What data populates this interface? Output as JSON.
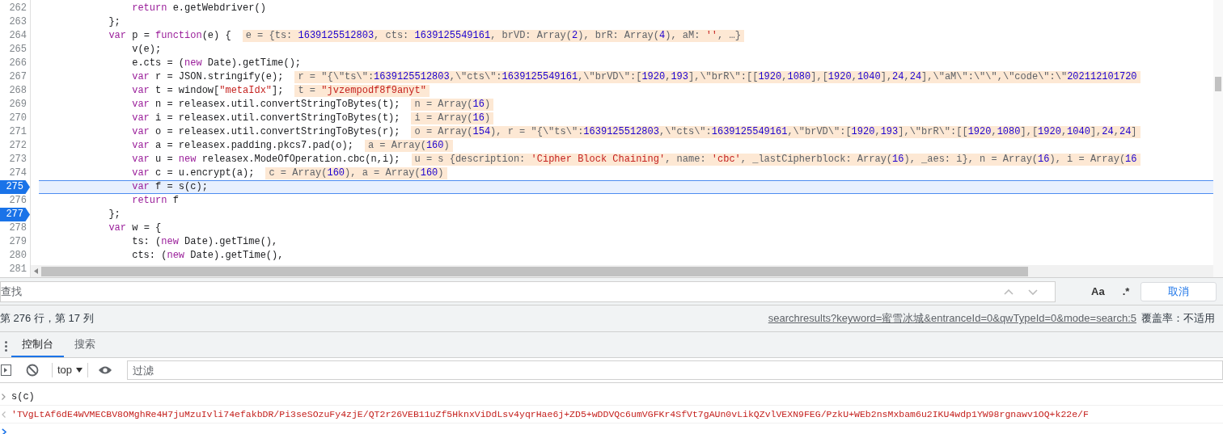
{
  "editor": {
    "lines": [
      {
        "number": "262",
        "code": "                return e.getWebdriver()",
        "breakpoint": false,
        "current": false
      },
      {
        "number": "263",
        "code": "            };",
        "breakpoint": false,
        "current": false
      },
      {
        "number": "264",
        "code": "            var p = function(e) {",
        "inline_value": "e = {ts: 1639125512803, cts: 1639125549161, brVD: Array(2), brR: Array(4), aM: '', …}",
        "breakpoint": false,
        "current": false
      },
      {
        "number": "265",
        "code": "                v(e);",
        "breakpoint": false,
        "current": false
      },
      {
        "number": "266",
        "code": "                e.cts = (new Date).getTime();",
        "breakpoint": false,
        "current": false
      },
      {
        "number": "267",
        "code": "                var r = JSON.stringify(e);",
        "inline_value": "r = \"{\\\"ts\\\":1639125512803,\\\"cts\\\":1639125549161,\\\"brVD\\\":[1920,193],\\\"brR\\\":[[1920,1080],[1920,1040],24,24],\\\"aM\\\":\\\"\\\",\\\"code\\\":\\\"202112101720",
        "breakpoint": false,
        "current": false
      },
      {
        "number": "268",
        "code": "                var t = window[\"metaIdx\"];",
        "inline_value": "t = \"jvzempodf8f9anyt\"",
        "breakpoint": false,
        "current": false
      },
      {
        "number": "269",
        "code": "                var n = releasex.util.convertStringToBytes(t);",
        "inline_value": "n = Array(16)",
        "breakpoint": false,
        "current": false
      },
      {
        "number": "270",
        "code": "                var i = releasex.util.convertStringToBytes(t);",
        "inline_value": "i = Array(16)",
        "breakpoint": false,
        "current": false
      },
      {
        "number": "271",
        "code": "                var o = releasex.util.convertStringToBytes(r);",
        "inline_value": "o = Array(154), r = \"{\\\"ts\\\":1639125512803,\\\"cts\\\":1639125549161,\\\"brVD\\\":[1920,193],\\\"brR\\\":[[1920,1080],[1920,1040],24,24]",
        "breakpoint": false,
        "current": false
      },
      {
        "number": "272",
        "code": "                var a = releasex.padding.pkcs7.pad(o);",
        "inline_value": "a = Array(160)",
        "breakpoint": false,
        "current": false
      },
      {
        "number": "273",
        "code": "                var u = new releasex.ModeOfOperation.cbc(n,i);",
        "inline_value": "u = s {description: 'Cipher Block Chaining', name: 'cbc', _lastCipherblock: Array(16), _aes: i}, n = Array(16), i = Array(16",
        "breakpoint": false,
        "current": false
      },
      {
        "number": "274",
        "code": "                var c = u.encrypt(a);",
        "inline_value": "c = Array(160), a = Array(160)",
        "breakpoint": false,
        "current": false
      },
      {
        "number": "275",
        "code": "                var f = s(c);",
        "breakpoint": true,
        "current": true
      },
      {
        "number": "276",
        "code": "                return f",
        "breakpoint": false,
        "current": false
      },
      {
        "number": "277",
        "code": "            };",
        "breakpoint": true,
        "current": false
      },
      {
        "number": "278",
        "code": "            var w = {",
        "breakpoint": false,
        "current": false
      },
      {
        "number": "279",
        "code": "                ts: (new Date).getTime(),",
        "breakpoint": false,
        "current": false
      },
      {
        "number": "280",
        "code": "                cts: (new Date).getTime(),",
        "breakpoint": false,
        "current": false
      },
      {
        "number": "281",
        "breakpoint": false,
        "current": false
      }
    ]
  },
  "find_bar": {
    "placeholder": "查找",
    "match_case": "Aa",
    "regex": ".*",
    "cancel": "取消"
  },
  "status_bar": {
    "position": "第 276 行，第 17 列",
    "source_link": "searchresults?keyword=蜜雪冰城&entranceId=0&qwTypeId=0&mode=search:5",
    "coverage": "覆盖率：不适用"
  },
  "drawer_tabs": [
    {
      "label": "控制台",
      "selected": true
    },
    {
      "label": "搜索",
      "selected": false
    }
  ],
  "console_toolbar": {
    "context": "top",
    "filter_placeholder": "过滤"
  },
  "console": [
    {
      "kind": "input",
      "text": "s(c)"
    },
    {
      "kind": "result",
      "text": "'TVgLtAf6dE4WVMECBV8OMghRe4H7juMzuIvli74efakbDR/Pi3seSOzuFy4zjE/QT2r26VEB11uZf5HknxViDdLsv4yqrHae6j+ZD5+wDDVQc6umVGFKr4SfVt7gAUn0vLikQZvlVEXN9FEG/PzkU+WEb2nsMxbam6u2IKU4wdp1YW98rgnawv1OQ+k22e/F"
    },
    {
      "kind": "prompt"
    }
  ]
}
